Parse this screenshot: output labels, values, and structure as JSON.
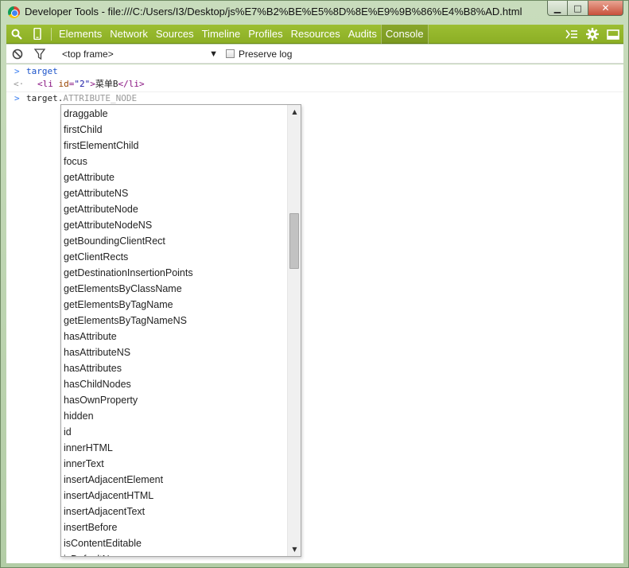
{
  "window": {
    "title": "Developer Tools - file:///C:/Users/I3/Desktop/js%E7%B2%BE%E5%8D%8E%E9%9B%86%E4%B8%AD.html",
    "minimize_glyph": "▁",
    "maximize_glyph": "□",
    "close_glyph": "✕"
  },
  "toolbar": {
    "tabs": [
      "Elements",
      "Network",
      "Sources",
      "Timeline",
      "Profiles",
      "Resources",
      "Audits",
      "Console"
    ],
    "active_tab": "Console",
    "accent": "#93b62b"
  },
  "console_bar": {
    "frame": "<top frame>",
    "dropdown_glyph": "▼",
    "preserve_log": "Preserve log"
  },
  "console": {
    "prompt_glyph": ">",
    "result_glyph": "<·",
    "lines": {
      "input1": "target",
      "result_open": "<li",
      "result_attr": "id",
      "result_eq": "=",
      "result_val": "\"2\"",
      "result_gt": ">",
      "result_text": "菜单B",
      "result_close": "</li>",
      "input2": "target.",
      "ghost_completion": "ATTRIBUTE_NODE"
    }
  },
  "autocomplete": {
    "items": [
      "draggable",
      "firstChild",
      "firstElementChild",
      "focus",
      "getAttribute",
      "getAttributeNS",
      "getAttributeNode",
      "getAttributeNodeNS",
      "getBoundingClientRect",
      "getClientRects",
      "getDestinationInsertionPoints",
      "getElementsByClassName",
      "getElementsByTagName",
      "getElementsByTagNameNS",
      "hasAttribute",
      "hasAttributeNS",
      "hasAttributes",
      "hasChildNodes",
      "hasOwnProperty",
      "hidden",
      "id",
      "innerHTML",
      "innerText",
      "insertAdjacentElement",
      "insertAdjacentHTML",
      "insertAdjacentText",
      "insertBefore",
      "isContentEditable",
      "isDefaultNamespace"
    ],
    "scroll_up_glyph": "▲",
    "scroll_down_glyph": "▼"
  }
}
